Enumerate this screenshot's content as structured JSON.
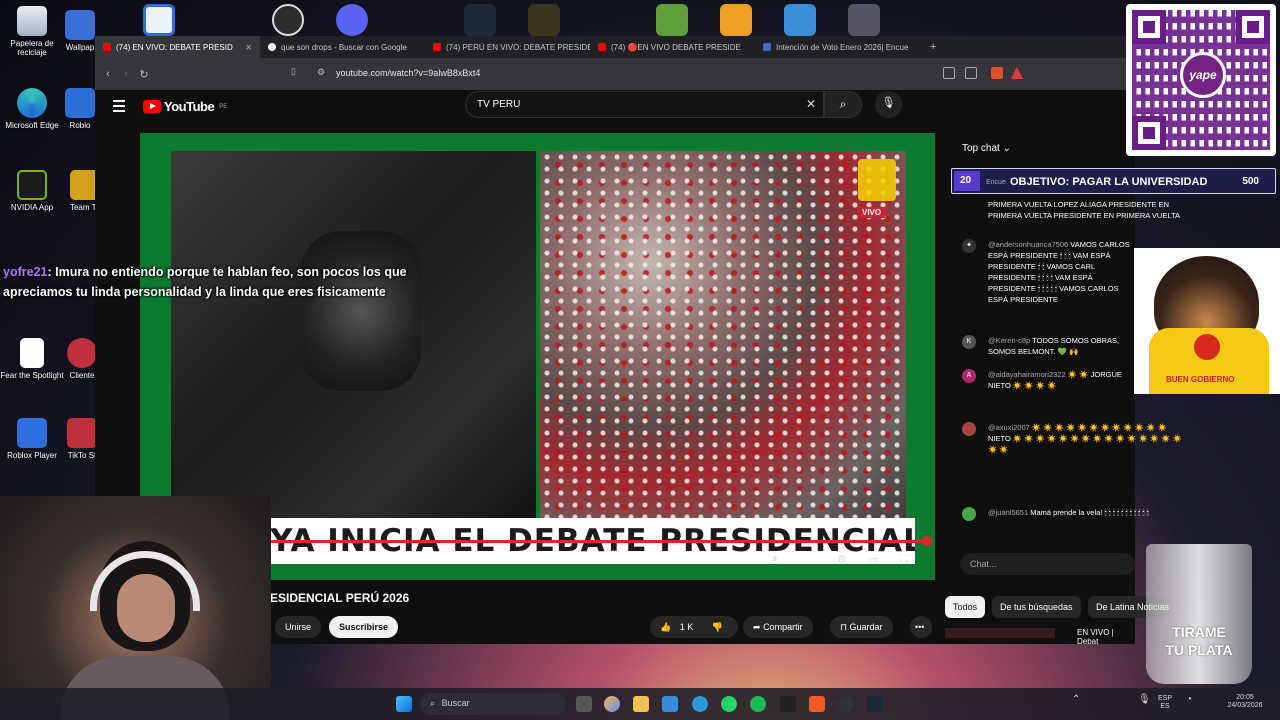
{
  "desktop": {
    "icons": [
      {
        "label": "Papelera de reciclaje"
      },
      {
        "label": "Wallpap"
      },
      {
        "label": "Microsoft Edge"
      },
      {
        "label": "Roblo"
      },
      {
        "label": "NVIDIA App"
      },
      {
        "label": "Team Ta"
      },
      {
        "label": "Fear the Spotlight"
      },
      {
        "label": "Cliente"
      },
      {
        "label": "Roblox Player"
      },
      {
        "label": "TikTo St"
      }
    ]
  },
  "browser": {
    "tabs": [
      {
        "label": "(74) EN VIVO: DEBATE PRESID",
        "active": true
      },
      {
        "label": "que son drops - Buscar con Google"
      },
      {
        "label": "(74) PERÚ EN VIVO: DEBATE PRESIDE"
      },
      {
        "label": "(74) 🔴EN VIVO DEBATE PRESIDE"
      },
      {
        "label": "Intención de Voto Enero 2026| Encue"
      }
    ],
    "url": "youtube.com/watch?v=9alwB8xBxt4"
  },
  "youtube": {
    "logo": "YouTube",
    "region": "PE",
    "search_query": "TV PERU",
    "player": {
      "banner": "YA INICIA EL DEBATE PRESIDENCIAL",
      "live_badge": "VIVO"
    },
    "video_title": "ESIDENCIAL PERÚ 2026",
    "buttons": {
      "join": "Unirse",
      "subscribe": "Suscribirse",
      "likes": "1 K",
      "share": "Compartir",
      "save": "Guardar"
    },
    "chat": {
      "mode": "Top chat",
      "goal_prefix": "20",
      "goal_small": "Encue",
      "goal_text": "OBJETIVO: PAGAR LA UNIVERSIDAD",
      "goal_amount": "500",
      "messages": [
        {
          "author": "",
          "text": "PRIMERA VUELTA LOPEZ ALIAGA PRESIDENTE EN PRIMERA VUELTA PRESIDENTE EN PRIMERA VUELTA"
        },
        {
          "author": "@andersonhuanca7506",
          "text": "VAMOS CARLOS ESPÁ PRESIDENTE 🕯 🕯 🕯 VAM ESPÁ PRESIDENTE 🕯 🕯 VAMOS CARL PRESIDENTE 🕯 🕯 🕯 🕯 VAM ESPÁ PRESIDENTE 🕯 🕯 🕯 🕯 🕯 VAMOS CARLOS ESPÁ PRESIDENTE"
        },
        {
          "author": "@Keren-c8p",
          "text": "TODOS SOMOS OBRAS, SOMOS BELMONT. 💚 🙌"
        },
        {
          "author": "@aidayahairamori2322",
          "text": "☀️ ☀️ JORGUE NIETO ☀️ ☀️ ☀️ ☀️"
        },
        {
          "author": "@axuxi2007",
          "text": "☀️ ☀️ ☀️ ☀️ ☀️ ☀️ ☀️ ☀️ ☀️ ☀️ ☀️ ☀️ NIETO ☀️ ☀️ ☀️ ☀️ ☀️ ☀️ ☀️ ☀️ ☀️ ☀️ ☀️ ☀️ ☀️ ☀️ ☀️ ☀️ ☀️"
        },
        {
          "author": "@juanl5651",
          "text": "Mamá prende la vela! 🕯 🕯 🕯 🕯 🕯 🕯 🕯 🕯 🕯 🕯 🕯"
        }
      ],
      "input_placeholder": "Chat..."
    },
    "chips": [
      "Todos",
      "De tus búsquedas",
      "De Latina Noticias"
    ],
    "next_video": "EN VIVO | Debat"
  },
  "overlay": {
    "user": "yofre21",
    "message": ": Imura no entiendo porque te hablan feo, son pocos los que apreciamos tu linda personalidad y la linda que eres fisicamente",
    "glass_line1": "TIRAME",
    "glass_line2": "TU PLATA",
    "dog_caption": "BUEN GOBIERNO",
    "qr_brand": "yape"
  },
  "taskbar": {
    "search": "Buscar",
    "lang_top": "ESP",
    "lang_bottom": "ES",
    "time": "20:05",
    "date": "24/03/2026"
  }
}
